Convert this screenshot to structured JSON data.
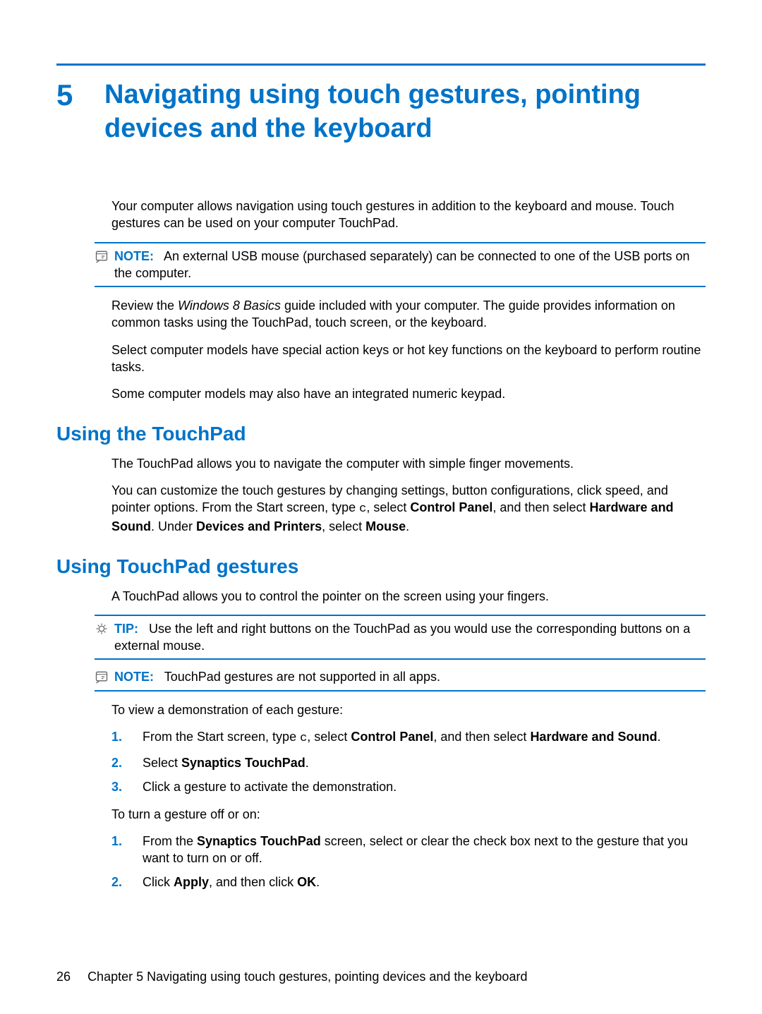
{
  "chapter": {
    "number": "5",
    "title": "Navigating using touch gestures, pointing devices and the keyboard"
  },
  "intro_para": "Your computer allows navigation using touch gestures in addition to the keyboard and mouse. Touch gestures can be used on your computer TouchPad.",
  "note1": {
    "label": "NOTE:",
    "text": "An external USB mouse (purchased separately) can be connected to one of the USB ports on the computer."
  },
  "review_para_pre": "Review the ",
  "review_para_italic": "Windows 8 Basics",
  "review_para_post": " guide included with your computer. The guide provides information on common tasks using the TouchPad, touch screen, or the keyboard.",
  "para_action_keys": "Select computer models have special action keys or hot key functions on the keyboard to perform routine tasks.",
  "para_numeric_keypad": "Some computer models may also have an integrated numeric keypad.",
  "section_touchpad_heading": "Using the TouchPad",
  "touchpad_para1": "The TouchPad allows you to navigate the computer with simple finger movements.",
  "touchpad_para2_a": "You can customize the touch gestures by changing settings, button configurations, click speed, and pointer options. From the Start screen, type ",
  "touchpad_para2_mono": "c",
  "touchpad_para2_b": ", select ",
  "touchpad_para2_bold1": "Control Panel",
  "touchpad_para2_c": ", and then select ",
  "touchpad_para2_bold2": "Hardware and Sound",
  "touchpad_para2_d": ". Under ",
  "touchpad_para2_bold3": "Devices and Printers",
  "touchpad_para2_e": ", select ",
  "touchpad_para2_bold4": "Mouse",
  "touchpad_para2_f": ".",
  "section_gestures_heading": "Using TouchPad gestures",
  "gestures_para1": "A TouchPad allows you to control the pointer on the screen using your fingers.",
  "tip1": {
    "label": "TIP:",
    "text": "Use the left and right buttons on the TouchPad as you would use the corresponding buttons on a external mouse."
  },
  "note2": {
    "label": "NOTE:",
    "text": "TouchPad gestures are not supported in all apps."
  },
  "demo_intro": "To view a demonstration of each gesture:",
  "demo_step1_a": "From the Start screen, type ",
  "demo_step1_mono": "c",
  "demo_step1_b": ", select ",
  "demo_step1_bold1": "Control Panel",
  "demo_step1_c": ", and then select ",
  "demo_step1_bold2": "Hardware and Sound",
  "demo_step1_d": ".",
  "demo_step2_a": "Select ",
  "demo_step2_bold": "Synaptics TouchPad",
  "demo_step2_b": ".",
  "demo_step3": "Click a gesture to activate the demonstration.",
  "toggle_intro": "To turn a gesture off or on:",
  "toggle_step1_a": "From the ",
  "toggle_step1_bold": "Synaptics TouchPad",
  "toggle_step1_b": " screen, select or clear the check box next to the gesture that you want to turn on or off.",
  "toggle_step2_a": "Click ",
  "toggle_step2_bold1": "Apply",
  "toggle_step2_b": ", and then click ",
  "toggle_step2_bold2": "OK",
  "toggle_step2_c": ".",
  "footer": {
    "page_number": "26",
    "chapter_label": "Chapter 5   Navigating using touch gestures, pointing devices and the keyboard"
  }
}
